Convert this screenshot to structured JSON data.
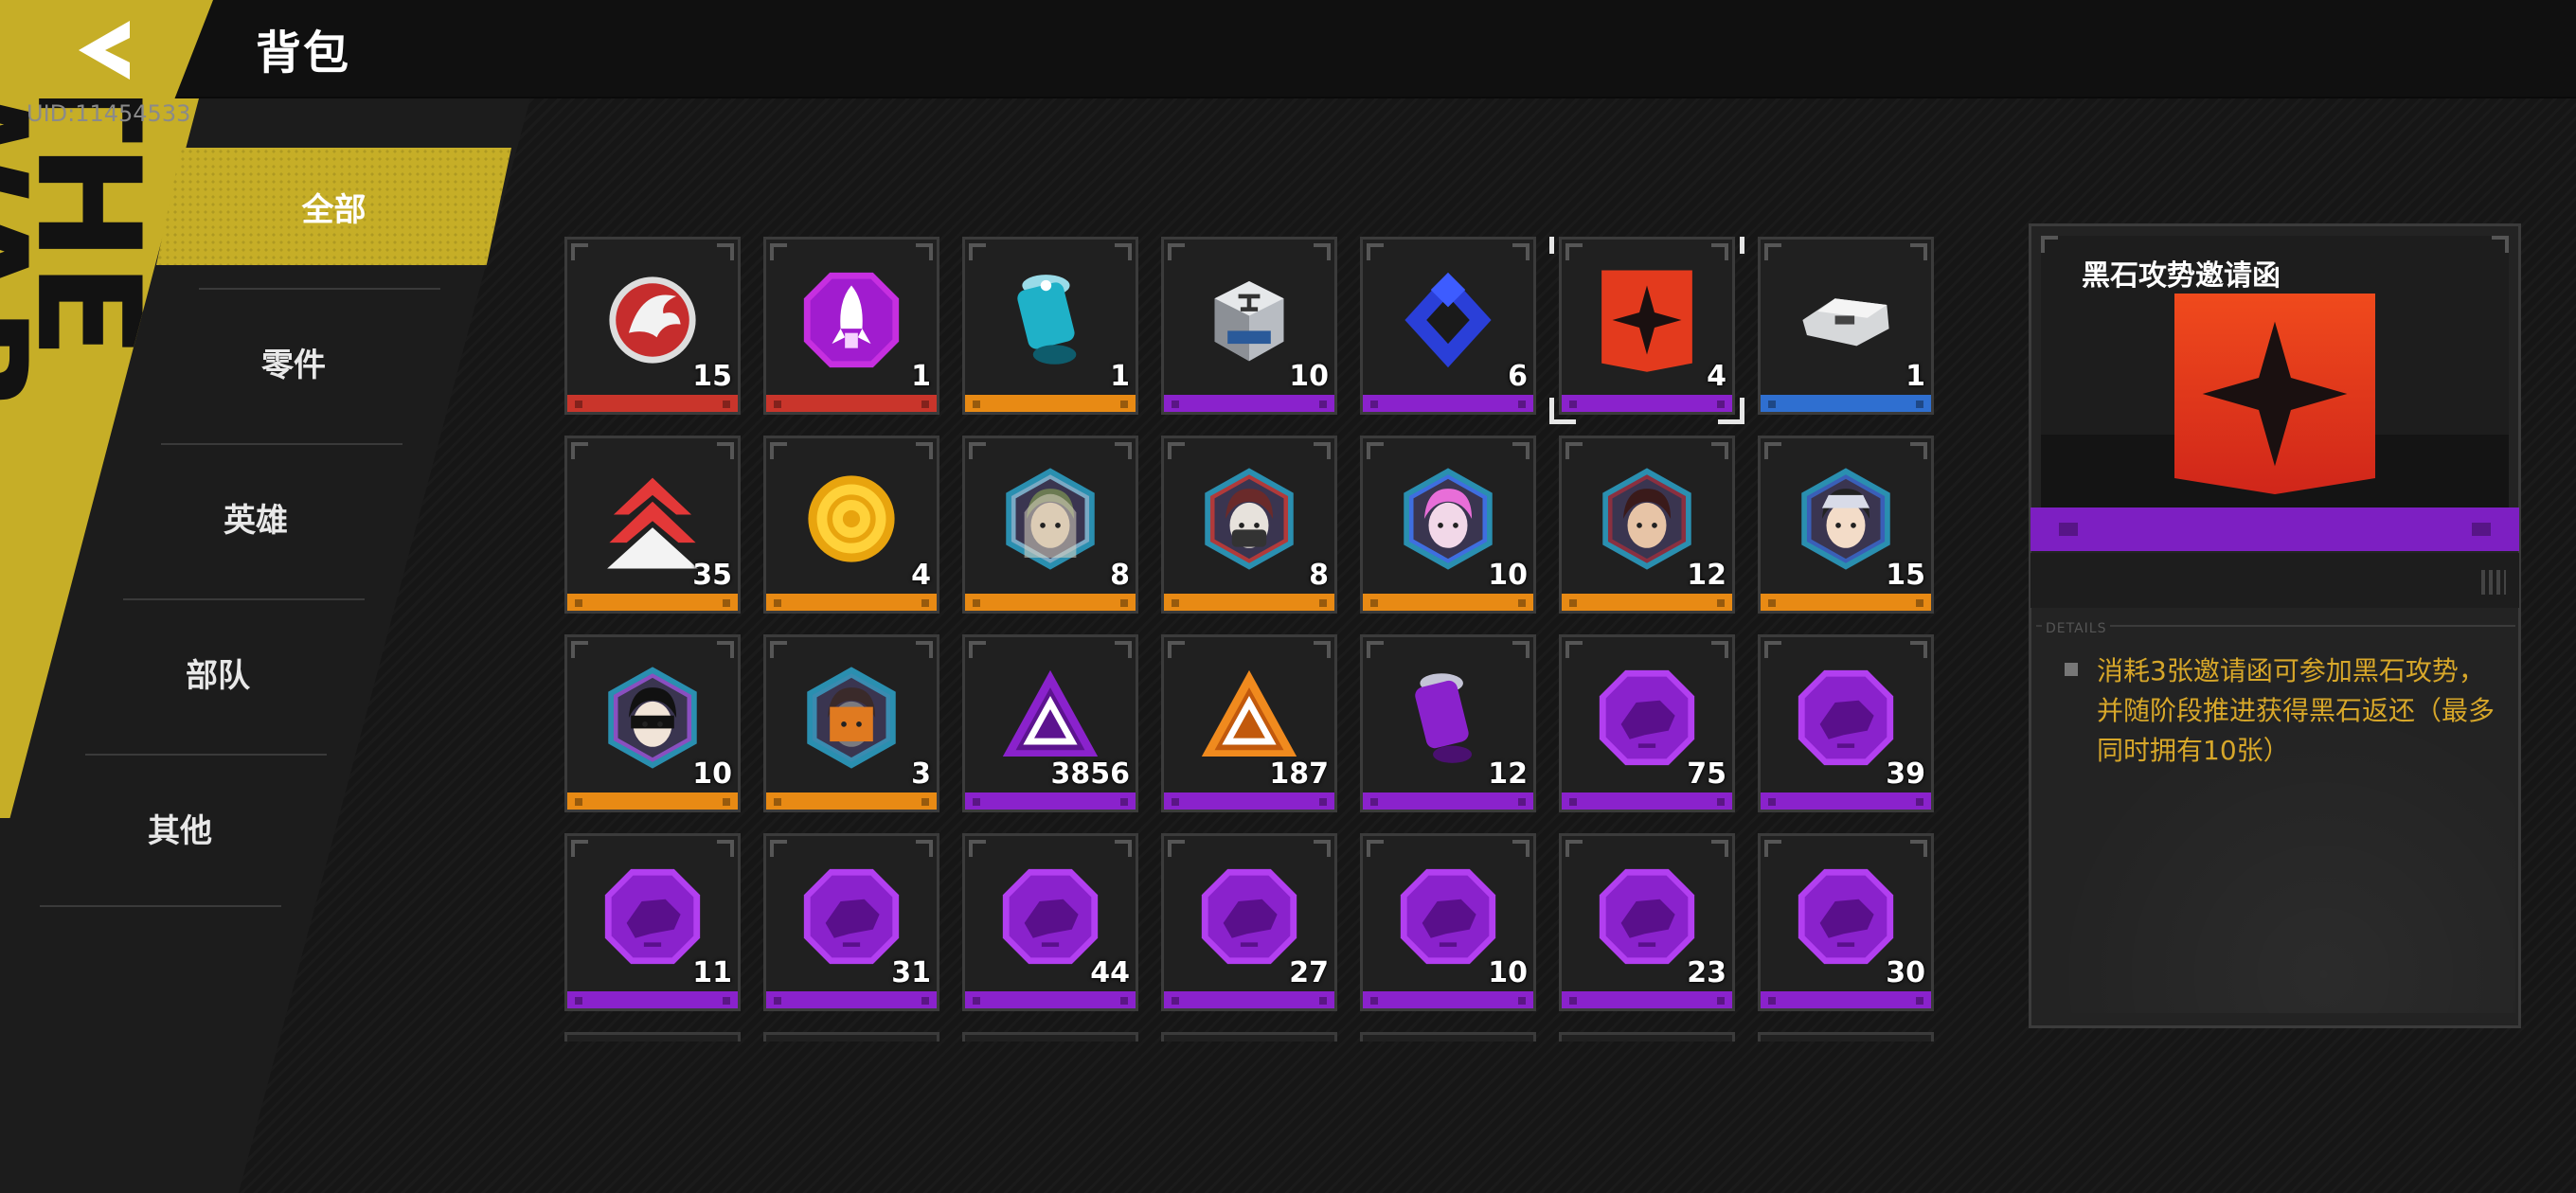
{
  "header": {
    "title": "背包",
    "back_icon": "back-arrow-icon"
  },
  "uid": "UID:11454533",
  "decoration": {
    "text": "THE WAR"
  },
  "categories": [
    {
      "label": "全部",
      "active": true
    },
    {
      "label": "零件",
      "active": false
    },
    {
      "label": "英雄",
      "active": false
    },
    {
      "label": "部队",
      "active": false
    },
    {
      "label": "其他",
      "active": false
    }
  ],
  "rarity_colors": {
    "red": "#c9352b",
    "orange": "#e88a14",
    "purple": "#8a22cc",
    "blue": "#2f6fd0"
  },
  "items": [
    {
      "icon": "red-phoenix-emblem-icon",
      "count": "15",
      "rarity": "red"
    },
    {
      "icon": "purple-rocket-badge-icon",
      "count": "1",
      "rarity": "red"
    },
    {
      "icon": "blue-energy-canister-icon",
      "count": "1",
      "rarity": "orange"
    },
    {
      "icon": "silver-parts-crate-icon",
      "count": "10",
      "rarity": "purple"
    },
    {
      "icon": "blue-hex-token-icon",
      "count": "6",
      "rarity": "purple"
    },
    {
      "icon": "red-star-banner-icon",
      "count": "4",
      "rarity": "purple",
      "selected": true
    },
    {
      "icon": "silver-parts-chip-icon",
      "count": "1",
      "rarity": "blue"
    },
    {
      "icon": "red-rank-chevron-icon",
      "count": "35",
      "rarity": "orange"
    },
    {
      "icon": "gold-target-coin-icon",
      "count": "4",
      "rarity": "orange"
    },
    {
      "icon": "hero-portrait-hooded-icon",
      "count": "8",
      "rarity": "orange"
    },
    {
      "icon": "hero-portrait-masked-icon",
      "count": "8",
      "rarity": "orange"
    },
    {
      "icon": "hero-portrait-pink-hair-icon",
      "count": "10",
      "rarity": "orange"
    },
    {
      "icon": "hero-portrait-red-eye-icon",
      "count": "12",
      "rarity": "orange"
    },
    {
      "icon": "hero-portrait-cap-icon",
      "count": "15",
      "rarity": "orange"
    },
    {
      "icon": "hero-portrait-helmet-icon",
      "count": "10",
      "rarity": "orange"
    },
    {
      "icon": "hero-portrait-mech-icon",
      "count": "3",
      "rarity": "orange"
    },
    {
      "icon": "purple-triangle-token-icon",
      "count": "3856",
      "rarity": "purple"
    },
    {
      "icon": "orange-triangle-token-icon",
      "count": "187",
      "rarity": "purple"
    },
    {
      "icon": "purple-energy-canister-icon",
      "count": "12",
      "rarity": "purple"
    },
    {
      "icon": "purple-unit-chip-icon",
      "count": "75",
      "rarity": "purple"
    },
    {
      "icon": "purple-unit-chip-icon",
      "count": "39",
      "rarity": "purple"
    },
    {
      "icon": "purple-unit-chip-icon",
      "count": "11",
      "rarity": "purple"
    },
    {
      "icon": "purple-unit-chip-icon",
      "count": "31",
      "rarity": "purple"
    },
    {
      "icon": "purple-unit-chip-icon",
      "count": "44",
      "rarity": "purple"
    },
    {
      "icon": "purple-unit-chip-icon",
      "count": "27",
      "rarity": "purple"
    },
    {
      "icon": "purple-unit-chip-icon",
      "count": "10",
      "rarity": "purple"
    },
    {
      "icon": "purple-unit-chip-icon",
      "count": "23",
      "rarity": "purple"
    },
    {
      "icon": "purple-unit-chip-icon",
      "count": "30",
      "rarity": "purple"
    }
  ],
  "detail": {
    "title": "黑石攻势邀请函",
    "icon": "red-star-banner-icon",
    "rarity": "purple",
    "section_label": "DETAILS",
    "description": "消耗3张邀请函可参加黑石攻势，并随阶段推进获得黑石返还（最多同时拥有10张）"
  }
}
